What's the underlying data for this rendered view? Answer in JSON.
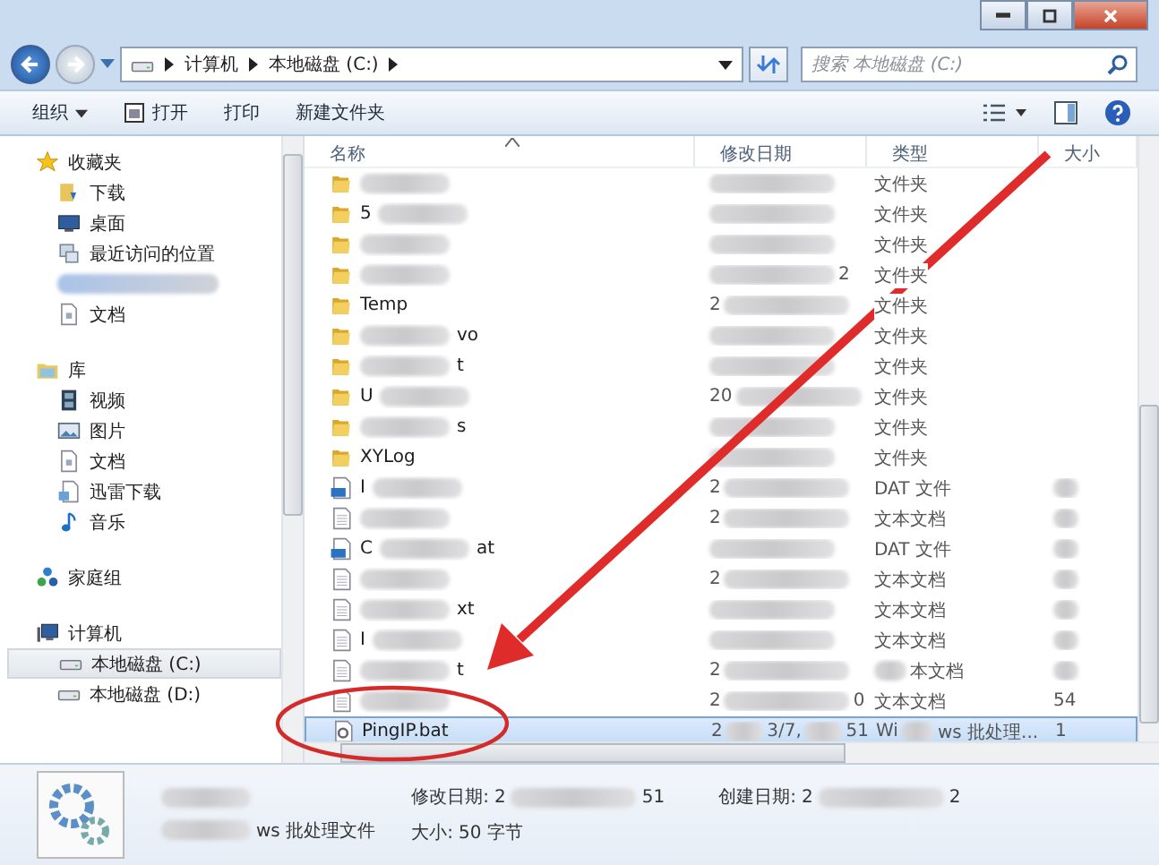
{
  "address_bar": {
    "breadcrumbs": [
      "计算机",
      "本地磁盘 (C:)"
    ]
  },
  "search": {
    "placeholder": "搜索 本地磁盘 (C:)"
  },
  "toolbar": {
    "buttons": [
      {
        "kind": "menu",
        "label": "组织"
      },
      {
        "kind": "open",
        "label": "打开"
      },
      {
        "kind": "plain",
        "label": "打印"
      },
      {
        "kind": "plain",
        "label": "新建文件夹"
      }
    ]
  },
  "sidebar": {
    "groups": [
      {
        "kind": "star",
        "label": "收藏夹",
        "items": [
          {
            "kind": "download",
            "label": "下载",
            "selected": false
          },
          {
            "kind": "desktop",
            "label": "桌面",
            "selected": false
          },
          {
            "kind": "recent",
            "label": "最近访问的位置",
            "selected": false
          },
          {
            "kind": "blur",
            "selected": false
          },
          {
            "kind": "document",
            "label": "文档",
            "selected": false
          }
        ]
      },
      {
        "kind": "library",
        "label": "库",
        "items": [
          {
            "kind": "video",
            "label": "视频",
            "selected": false
          },
          {
            "kind": "picture",
            "label": "图片",
            "selected": false
          },
          {
            "kind": "document",
            "label": "文档",
            "selected": false
          },
          {
            "kind": "thunder",
            "label": "迅雷下载",
            "selected": false
          },
          {
            "kind": "music",
            "label": "音乐",
            "selected": false
          }
        ]
      },
      {
        "kind": "homegroup",
        "label": "家庭组"
      },
      {
        "kind": "computer",
        "label": "计算机",
        "items": [
          {
            "kind": "drive",
            "label": "本地磁盘 (C:)",
            "selected": true
          },
          {
            "kind": "drive",
            "label": "本地磁盘 (D:)",
            "selected": false
          }
        ]
      }
    ]
  },
  "columns": [
    "名称",
    "修改日期",
    "类型",
    "大小"
  ],
  "rows": [
    {
      "kind": "folder",
      "name": [
        {
          "kind": "blur"
        }
      ],
      "date": [
        {
          "kind": "blur"
        }
      ],
      "type": [
        {
          "kind": "text",
          "text": "文件夹"
        }
      ],
      "selected": false
    },
    {
      "kind": "folder",
      "name": [
        {
          "kind": "text",
          "text": "5"
        },
        {
          "kind": "blur"
        }
      ],
      "date": [
        {
          "kind": "blur"
        }
      ],
      "type": [
        {
          "kind": "text",
          "text": "文件夹"
        }
      ],
      "selected": false
    },
    {
      "kind": "folder",
      "name": [
        {
          "kind": "blur"
        }
      ],
      "date": [
        {
          "kind": "blur"
        }
      ],
      "type": [
        {
          "kind": "text",
          "text": "文件夹"
        }
      ],
      "selected": false
    },
    {
      "kind": "folder",
      "name": [
        {
          "kind": "blur"
        }
      ],
      "date": [
        {
          "kind": "blur"
        },
        {
          "kind": "text",
          "text": "2"
        }
      ],
      "type": [
        {
          "kind": "text",
          "text": "文件夹"
        }
      ],
      "selected": false
    },
    {
      "kind": "folder",
      "name": [
        {
          "kind": "text",
          "text": "Temp"
        }
      ],
      "date": [
        {
          "kind": "text",
          "text": "2"
        },
        {
          "kind": "blur"
        }
      ],
      "type": [
        {
          "kind": "text",
          "text": "文件夹"
        }
      ],
      "selected": false
    },
    {
      "kind": "folder",
      "name": [
        {
          "kind": "blur"
        },
        {
          "kind": "text",
          "text": "vo"
        }
      ],
      "date": [
        {
          "kind": "blur"
        }
      ],
      "type": [
        {
          "kind": "text",
          "text": "文件夹"
        }
      ],
      "selected": false
    },
    {
      "kind": "folder",
      "name": [
        {
          "kind": "blur"
        },
        {
          "kind": "text",
          "text": "t"
        }
      ],
      "date": [
        {
          "kind": "blur"
        }
      ],
      "type": [
        {
          "kind": "text",
          "text": "文件夹"
        }
      ],
      "selected": false
    },
    {
      "kind": "folder",
      "name": [
        {
          "kind": "text",
          "text": "U"
        },
        {
          "kind": "blur"
        }
      ],
      "date": [
        {
          "kind": "text",
          "text": "20"
        },
        {
          "kind": "blur"
        }
      ],
      "type": [
        {
          "kind": "text",
          "text": "文件夹"
        }
      ],
      "selected": false
    },
    {
      "kind": "folder",
      "name": [
        {
          "kind": "blur"
        },
        {
          "kind": "text",
          "text": "s"
        }
      ],
      "date": [
        {
          "kind": "blur"
        }
      ],
      "type": [
        {
          "kind": "text",
          "text": "文件夹"
        }
      ],
      "selected": false
    },
    {
      "kind": "folder",
      "name": [
        {
          "kind": "text",
          "text": "XYLog"
        }
      ],
      "date": [
        {
          "kind": "blur"
        }
      ],
      "type": [
        {
          "kind": "text",
          "text": "文件夹"
        }
      ],
      "selected": false
    },
    {
      "kind": "dat",
      "name": [
        {
          "kind": "text",
          "text": "I"
        },
        {
          "kind": "blur"
        }
      ],
      "date": [
        {
          "kind": "text",
          "text": "2"
        },
        {
          "kind": "blur"
        }
      ],
      "type": [
        {
          "kind": "text",
          "text": "DAT 文件"
        }
      ],
      "size": [
        {
          "kind": "blur"
        }
      ],
      "selected": false
    },
    {
      "kind": "text",
      "name": [
        {
          "kind": "blur"
        }
      ],
      "date": [
        {
          "kind": "text",
          "text": "2"
        },
        {
          "kind": "blur"
        }
      ],
      "type": [
        {
          "kind": "text",
          "text": "文本文档"
        }
      ],
      "size": [
        {
          "kind": "blur"
        }
      ],
      "selected": false
    },
    {
      "kind": "dat",
      "name": [
        {
          "kind": "text",
          "text": "C"
        },
        {
          "kind": "blur"
        },
        {
          "kind": "text",
          "text": "at"
        }
      ],
      "date": [
        {
          "kind": "blur"
        }
      ],
      "type": [
        {
          "kind": "text",
          "text": "DAT 文件"
        }
      ],
      "size": [
        {
          "kind": "blur"
        }
      ],
      "selected": false
    },
    {
      "kind": "text",
      "name": [
        {
          "kind": "blur"
        }
      ],
      "date": [
        {
          "kind": "text",
          "text": "2"
        },
        {
          "kind": "blur"
        }
      ],
      "type": [
        {
          "kind": "text",
          "text": "文本文档"
        }
      ],
      "size": [
        {
          "kind": "blur"
        }
      ],
      "selected": false
    },
    {
      "kind": "text",
      "name": [
        {
          "kind": "blur"
        },
        {
          "kind": "text",
          "text": "xt"
        }
      ],
      "date": [
        {
          "kind": "blur"
        }
      ],
      "type": [
        {
          "kind": "text",
          "text": "文本文档"
        }
      ],
      "size": [
        {
          "kind": "blur"
        }
      ],
      "selected": false
    },
    {
      "kind": "text",
      "name": [
        {
          "kind": "text",
          "text": "I"
        },
        {
          "kind": "blur"
        }
      ],
      "date": [
        {
          "kind": "blur"
        }
      ],
      "type": [
        {
          "kind": "text",
          "text": "文本文档"
        }
      ],
      "size": [
        {
          "kind": "blur"
        }
      ],
      "selected": false
    },
    {
      "kind": "text",
      "name": [
        {
          "kind": "blur"
        },
        {
          "kind": "text",
          "text": "t"
        }
      ],
      "date": [
        {
          "kind": "text",
          "text": "2"
        },
        {
          "kind": "blur"
        }
      ],
      "type": [
        {
          "kind": "blur"
        },
        {
          "kind": "text",
          "text": "本文档"
        }
      ],
      "size": [
        {
          "kind": "blur"
        }
      ],
      "selected": false
    },
    {
      "kind": "text",
      "name": [
        {
          "kind": "blur"
        }
      ],
      "date": [
        {
          "kind": "text",
          "text": "2"
        },
        {
          "kind": "blur"
        },
        {
          "kind": "text",
          "text": "0"
        }
      ],
      "type": [
        {
          "kind": "text",
          "text": "文本文档"
        }
      ],
      "size": [
        {
          "kind": "text",
          "text": "54"
        }
      ],
      "selected": false
    },
    {
      "kind": "bat",
      "name": [
        {
          "kind": "text",
          "text": "PingIP.bat"
        }
      ],
      "date": [
        {
          "kind": "text",
          "text": "2"
        },
        {
          "kind": "blur"
        },
        {
          "kind": "text",
          "text": "3/7,"
        },
        {
          "kind": "blur"
        },
        {
          "kind": "text",
          "text": "51"
        }
      ],
      "type": [
        {
          "kind": "text",
          "text": "Wi"
        },
        {
          "kind": "blur"
        },
        {
          "kind": "text",
          "text": "ws 批处理..."
        }
      ],
      "size": [
        {
          "kind": "text",
          "text": "1"
        }
      ],
      "selected": true
    }
  ],
  "details": {
    "name": [
      {
        "kind": "blur"
      }
    ],
    "type": [
      {
        "kind": "blur"
      },
      {
        "kind": "text",
        "text": "ws 批处理文件"
      }
    ],
    "fields": [
      {
        "label": "修改日期:",
        "value": [
          {
            "kind": "text",
            "text": "2"
          },
          {
            "kind": "blur"
          },
          {
            "kind": "text",
            "text": "51"
          }
        ]
      },
      {
        "label": "创建日期:",
        "value": [
          {
            "kind": "text",
            "text": "2"
          },
          {
            "kind": "blur"
          },
          {
            "kind": "text",
            "text": "2"
          }
        ]
      },
      {
        "label": "大小:",
        "value": [
          {
            "kind": "text",
            "text": "50 字节"
          }
        ]
      }
    ]
  }
}
